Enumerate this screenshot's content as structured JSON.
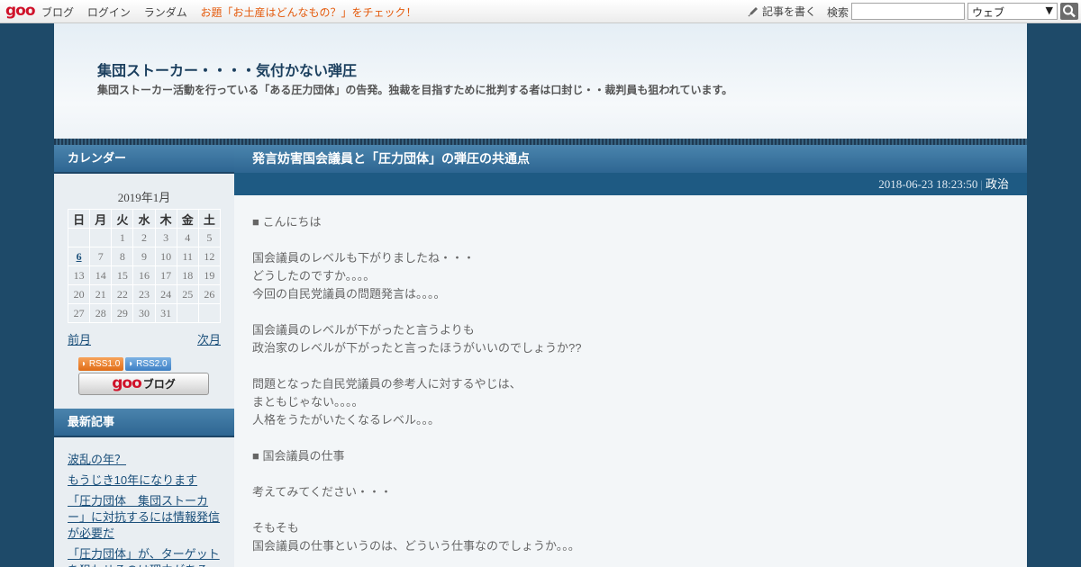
{
  "topbar": {
    "logo": "goo",
    "nav": [
      "ブログ",
      "ログイン",
      "ランダム"
    ],
    "promo": "お題「お土産はどんなもの？」をチェック！",
    "write_label": "記事を書く",
    "search_label": "検索",
    "search_value": "",
    "search_scope": "ウェブ"
  },
  "header": {
    "title": "集団ストーカー・・・・気付かない弾圧",
    "description": "集団ストーカー活動を行っている「ある圧力団体」の告発。独裁を目指すために批判する者は口封じ・・裁判員も狙われています。"
  },
  "sidebar": {
    "calendar_heading": "カレンダー",
    "calendar": {
      "caption": "2019年1月",
      "weekdays": [
        "日",
        "月",
        "火",
        "水",
        "木",
        "金",
        "土"
      ],
      "weeks": [
        [
          "",
          "",
          "1",
          "2",
          "3",
          "4",
          "5"
        ],
        [
          "6",
          "7",
          "8",
          "9",
          "10",
          "11",
          "12"
        ],
        [
          "13",
          "14",
          "15",
          "16",
          "17",
          "18",
          "19"
        ],
        [
          "20",
          "21",
          "22",
          "23",
          "24",
          "25",
          "26"
        ],
        [
          "27",
          "28",
          "29",
          "30",
          "31",
          "",
          ""
        ]
      ],
      "linked_days": [
        "6"
      ],
      "prev_label": "前月",
      "next_label": "次月"
    },
    "rss1": "RSS1.0",
    "rss2": "RSS2.0",
    "goo_logo": "goo",
    "goo_blog": "ブログ",
    "recent_heading": "最新記事",
    "recent": [
      "波乱の年？",
      "もうじき10年になります",
      "「圧力団体　集団ストーカー」に対抗するには情報発信が必要だ",
      "「圧力団体」が、ターゲットを狙わせるのは理由がある"
    ]
  },
  "article": {
    "title": "発言妨害国会議員と「圧力団体」の弾圧の共通点",
    "datetime": "2018-06-23 18:23:50",
    "separator": "|",
    "category": "政治",
    "lines": [
      "■ こんにちは",
      "",
      "国会議員のレベルも下がりましたね・・・",
      "どうしたのですか。。。。",
      "今回の自民党議員の問題発言は。。。。",
      "",
      "国会議員のレベルが下がったと言うよりも",
      "政治家のレベルが下がったと言ったほうがいいのでしょうか??",
      "",
      "問題となった自民党議員の参考人に対するやじは、",
      "まともじゃない。。。。",
      "人格をうたがいたくなるレベル。。。",
      "",
      "■ 国会議員の仕事",
      "",
      "考えてみてください・・・",
      "",
      "そもそも",
      "国会議員の仕事というのは、どういう仕事なのでしょうか。。。"
    ]
  }
}
